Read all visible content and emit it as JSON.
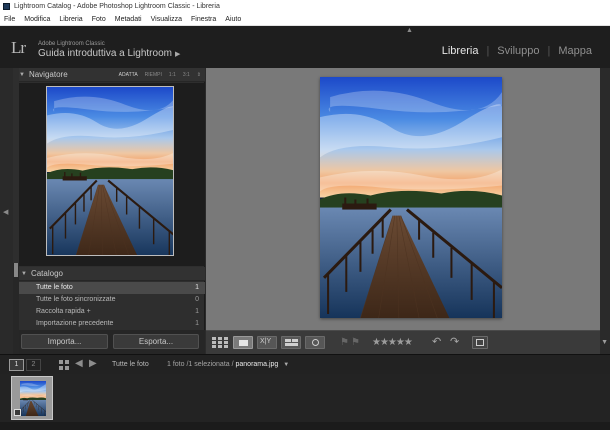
{
  "window": {
    "title": "Lightroom Catalog - Adobe Photoshop Lightroom Classic - Libreria"
  },
  "menu": {
    "items": [
      "File",
      "Modifica",
      "Libreria",
      "Foto",
      "Metadati",
      "Visualizza",
      "Finestra",
      "Aiuto"
    ]
  },
  "identity": {
    "logo": "Lr",
    "product": "Adobe Lightroom Classic",
    "catalog": "Guida introduttiva a Lightroom"
  },
  "modules": {
    "library": "Libreria",
    "develop": "Sviluppo",
    "map": "Mappa",
    "active": "Libreria"
  },
  "navigator": {
    "title": "Navigatore",
    "zoom": [
      "ADATTA",
      "RIEMPI",
      "1:1",
      "3:1"
    ],
    "selected_zoom": "ADATTA"
  },
  "catalog": {
    "title": "Catalogo",
    "items": [
      {
        "label": "Tutte le foto",
        "count": "1",
        "selected": true
      },
      {
        "label": "Tutte le foto sincronizzate",
        "count": "0",
        "selected": false
      },
      {
        "label": "Raccolta rapida +",
        "count": "1",
        "selected": false
      },
      {
        "label": "Importazione precedente",
        "count": "1",
        "selected": false
      }
    ]
  },
  "buttons": {
    "import": "Importa...",
    "export": "Esporta..."
  },
  "toolbar": {
    "rating": "★★★★★",
    "view_modes": [
      "grid-view-icon",
      "loupe-view-icon",
      "compare-view-icon",
      "survey-view-icon",
      "people-view-icon"
    ],
    "active_view": "loupe-view-icon"
  },
  "filmbar": {
    "screen1": "1",
    "screen2": "2",
    "source": "Tutte le foto",
    "count_text": "1 foto /1 selezionata /",
    "filename": "panorama.jpg"
  },
  "colors": {
    "panel_bg": "#2e2e2e",
    "main_bg": "#797979",
    "header_bg": "#1e1e1e"
  }
}
